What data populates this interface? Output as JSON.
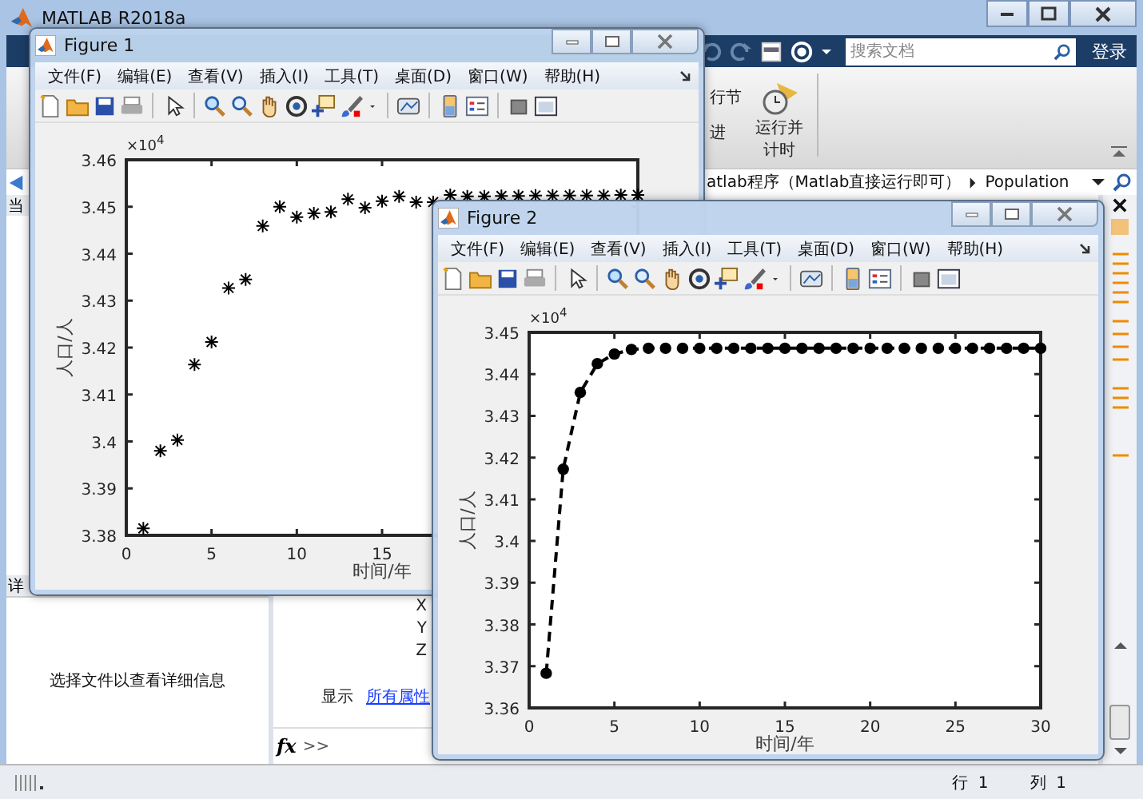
{
  "main_window": {
    "title": "MATLAB R2018a",
    "search": {
      "placeholder": "搜索文档"
    },
    "login": "登录",
    "ribbon": {
      "run_section": "行节",
      "advance": "进",
      "run_and_time": "运行并计时"
    },
    "address_bar": {
      "path": "atlab程序（Matlab直接运行即可）",
      "folder": "Population"
    },
    "current_folder": {
      "header": "当"
    },
    "details": {
      "header": "详",
      "message": "选择文件以查看详细信息"
    },
    "inspector": {
      "fields": [
        "X",
        "Y",
        "Z"
      ],
      "show_label": "显示",
      "all_properties_link": "所有属性"
    },
    "command_window": {
      "function_button": "fx",
      "prompt": ">>"
    },
    "status_bar": {
      "row_label": "行",
      "row": "1",
      "col_label": "列",
      "col": "1"
    }
  },
  "figures": [
    {
      "title": "Figure 1",
      "menus": [
        "文件(F)",
        "编辑(E)",
        "查看(V)",
        "插入(I)",
        "工具(T)",
        "桌面(D)",
        "窗口(W)",
        "帮助(H)"
      ],
      "chart_data": {
        "type": "scatter",
        "xlabel": "时间/年",
        "ylabel": "人口/人",
        "xlim": [
          0,
          30
        ],
        "ylim": [
          3.38,
          3.46
        ],
        "xticks": [
          0,
          5,
          10,
          15
        ],
        "yticks": [
          3.38,
          3.39,
          3.4,
          3.41,
          3.42,
          3.43,
          3.44,
          3.45,
          3.46
        ],
        "annotations": [
          "×10$^{4}$"
        ],
        "x": [
          1,
          2,
          3,
          4,
          5,
          6,
          7,
          8,
          9,
          10,
          11,
          12,
          13,
          14,
          15,
          16,
          17,
          18,
          19,
          20,
          21,
          22,
          23,
          24,
          25,
          26,
          27,
          28,
          29,
          30
        ],
        "series": [
          {
            "color": "#000000",
            "marker": "cross",
            "values": [
              3.3815,
              3.398,
              3.4003,
              3.4164,
              3.4212,
              3.4327,
              3.4345,
              3.4459,
              3.45,
              3.4478,
              3.4486,
              3.4489,
              3.4516,
              3.4498,
              3.4512,
              3.4522,
              3.451,
              3.451,
              3.4525,
              3.4522,
              3.4522,
              3.4523,
              3.4523,
              3.4524,
              3.4524,
              3.4524,
              3.4524,
              3.4524,
              3.4525,
              3.4525
            ]
          }
        ]
      }
    },
    {
      "title": "Figure 2",
      "menus": [
        "文件(F)",
        "编辑(E)",
        "查看(V)",
        "插入(I)",
        "工具(T)",
        "桌面(D)",
        "窗口(W)",
        "帮助(H)"
      ],
      "chart_data": {
        "type": "line",
        "xlabel": "时间/年",
        "ylabel": "人口/人",
        "xlim": [
          0,
          30
        ],
        "ylim": [
          3.36,
          3.45
        ],
        "xticks": [
          0,
          5,
          10,
          15,
          20,
          25,
          30
        ],
        "yticks": [
          3.36,
          3.37,
          3.38,
          3.39,
          3.4,
          3.41,
          3.42,
          3.43,
          3.44,
          3.45
        ],
        "annotations": [
          "×10$^{4}$"
        ],
        "x": [
          1,
          2,
          3,
          4,
          5,
          6,
          7,
          8,
          9,
          10,
          11,
          12,
          13,
          14,
          15,
          16,
          17,
          18,
          19,
          20,
          21,
          22,
          23,
          24,
          25,
          26,
          27,
          28,
          29,
          30
        ],
        "series": [
          {
            "color": "#000000",
            "marker": "circle",
            "line_style": "dashed",
            "values": [
              3.3683,
              3.4172,
              3.4356,
              3.4425,
              3.4448,
              3.4459,
              3.4462,
              3.4462,
              3.4462,
              3.4462,
              3.4462,
              3.4462,
              3.4462,
              3.4462,
              3.4462,
              3.4462,
              3.4462,
              3.4462,
              3.4462,
              3.4462,
              3.4462,
              3.4462,
              3.4462,
              3.4462,
              3.4462,
              3.4462,
              3.4462,
              3.4462,
              3.4462,
              3.4462
            ]
          }
        ]
      }
    }
  ]
}
